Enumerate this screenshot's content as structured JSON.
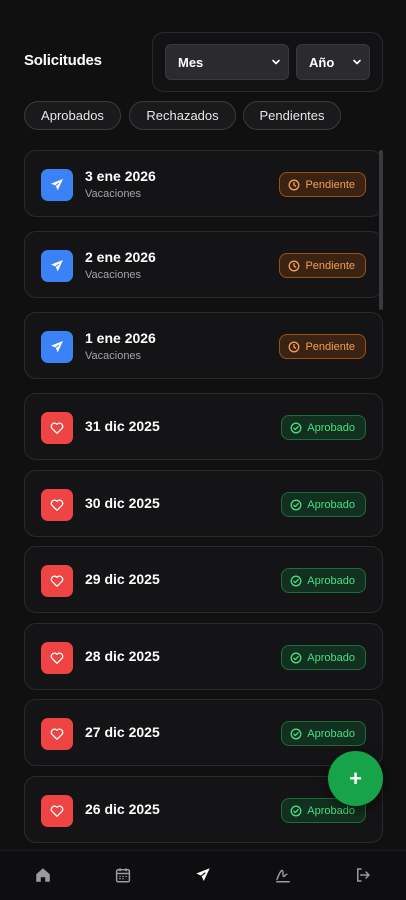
{
  "header": {
    "title": "Solicitudes",
    "month_select": "Mes",
    "year_select": "Año"
  },
  "filters": [
    "Aprobados",
    "Rechazados",
    "Pendientes"
  ],
  "requests": [
    {
      "date": "3 ene 2026",
      "type": "Vacaciones",
      "icon": "airplane-icon",
      "status": "Pendiente"
    },
    {
      "date": "2 ene 2026",
      "type": "Vacaciones",
      "icon": "airplane-icon",
      "status": "Pendiente"
    },
    {
      "date": "1 ene 2026",
      "type": "Vacaciones",
      "icon": "airplane-icon",
      "status": "Pendiente"
    },
    {
      "date": "31 dic 2025",
      "type": "",
      "icon": "heart-icon",
      "status": "Aprobado"
    },
    {
      "date": "30 dic 2025",
      "type": "",
      "icon": "heart-icon",
      "status": "Aprobado"
    },
    {
      "date": "29 dic 2025",
      "type": "",
      "icon": "heart-icon",
      "status": "Aprobado"
    },
    {
      "date": "28 dic 2025",
      "type": "",
      "icon": "heart-icon",
      "status": "Aprobado"
    },
    {
      "date": "27 dic 2025",
      "type": "",
      "icon": "heart-icon",
      "status": "Aprobado"
    },
    {
      "date": "26 dic 2025",
      "type": "",
      "icon": "heart-icon",
      "status": "Aprobado"
    }
  ],
  "fab": {
    "label": "+"
  },
  "nav": [
    "home-icon",
    "calendar-icon",
    "airplane-icon",
    "signature-icon",
    "logout-icon"
  ],
  "colors": {
    "background": "#101011",
    "blue": "#3b82f6",
    "red": "#ef4444",
    "pending": "#f59e53",
    "approved": "#4ade80",
    "fab": "#16a34a"
  }
}
